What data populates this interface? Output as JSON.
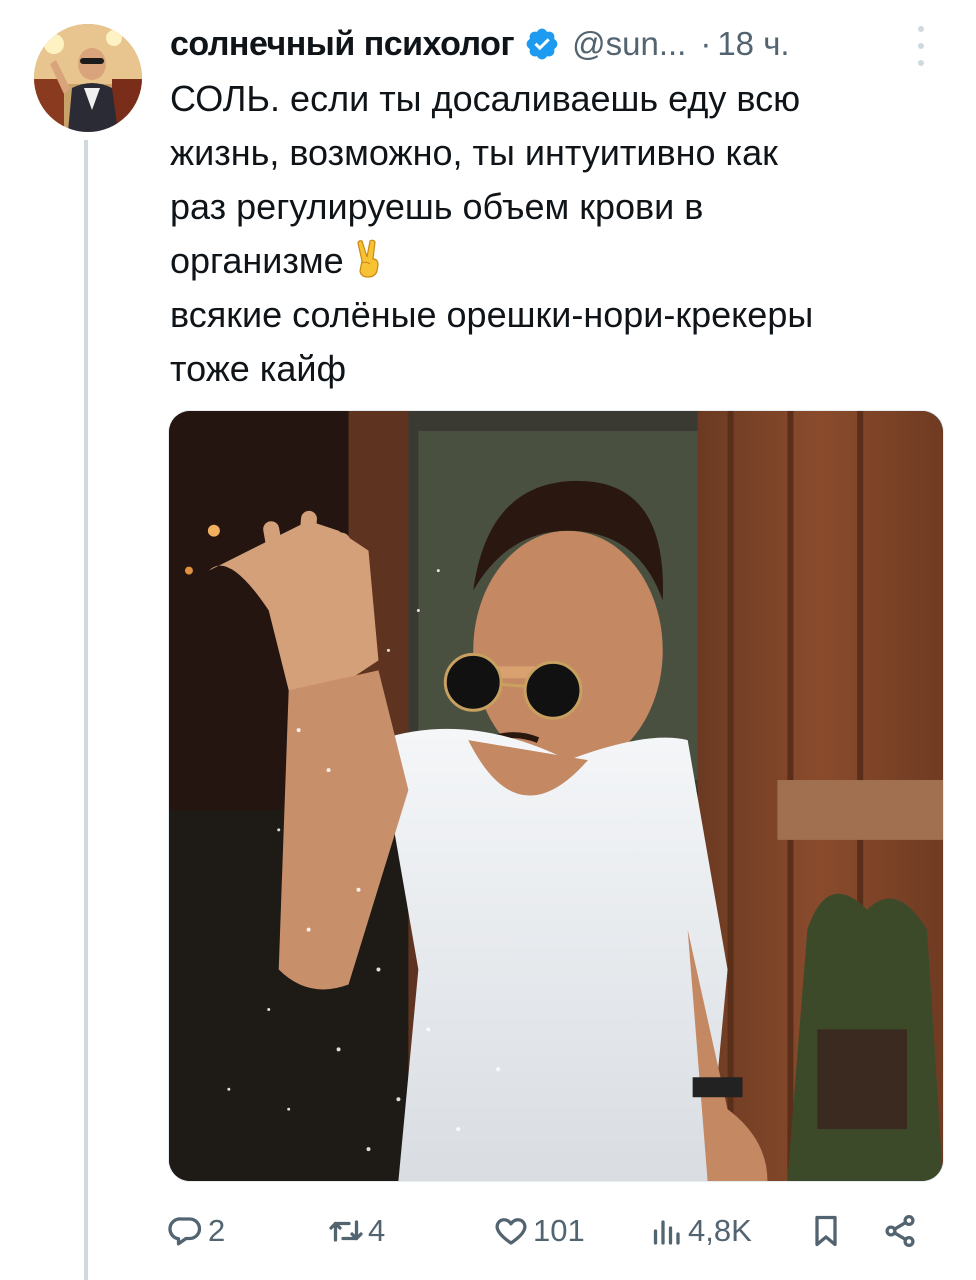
{
  "tweet": {
    "author": {
      "display_name": "солнечный психолог",
      "handle": "@sun...",
      "verified": true
    },
    "separator": "·",
    "time": "18 ч.",
    "text_lines": [
      "СОЛЬ. если ты досаливаешь еду всю",
      "жизнь, возможно, ты интуитивно как",
      "раз регулируешь объем крови в",
      "организме",
      "всякие солёные орешки-нори-крекеры",
      "тоже кайф"
    ],
    "emoji": "victory-hand-emoji",
    "media": {
      "description_icon": "photo"
    }
  },
  "actions": {
    "reply_count": "2",
    "retweet_count": "4",
    "like_count": "101",
    "views_count": "4,8K"
  },
  "colors": {
    "text_primary": "#0f1419",
    "text_secondary": "#536471",
    "verified_blue": "#1d9bf0",
    "thread_line": "#cfd9de"
  }
}
